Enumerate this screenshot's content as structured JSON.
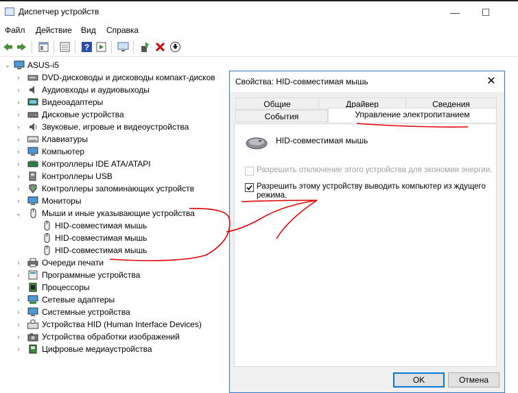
{
  "window": {
    "title": "Диспетчер устройств",
    "controls": {
      "minimize": "—",
      "maximize": "☐"
    }
  },
  "menu": [
    "Файл",
    "Действие",
    "Вид",
    "Справка"
  ],
  "toolbar": {
    "icons": [
      "back-arrow-icon",
      "forward-arrow-icon",
      "properties-icon",
      "update-list-icon",
      "help-icon",
      "action-icon",
      "scan-monitor-icon",
      "enable-device-icon",
      "remove-device-icon",
      "download-driver-icon"
    ]
  },
  "tree": {
    "root": "ASUS-i5",
    "items": [
      {
        "label": "DVD-дисководы и дисководы компакт-дисков",
        "icon": "dvd-icon"
      },
      {
        "label": "Аудиовходы и аудиовыходы",
        "icon": "speaker-icon"
      },
      {
        "label": "Видеоадаптеры",
        "icon": "display-adapter-icon"
      },
      {
        "label": "Дисковые устройства",
        "icon": "disk-drive-icon"
      },
      {
        "label": "Звуковые, игровые и видеоустройства",
        "icon": "sound-icon"
      },
      {
        "label": "Клавиатуры",
        "icon": "keyboard-icon"
      },
      {
        "label": "Компьютер",
        "icon": "computer-icon"
      },
      {
        "label": "Контроллеры IDE ATA/ATAPI",
        "icon": "ide-controller-icon"
      },
      {
        "label": "Контроллеры USB",
        "icon": "usb-icon"
      },
      {
        "label": "Контроллеры запоминающих устройств",
        "icon": "storage-controller-icon"
      },
      {
        "label": "Мониторы",
        "icon": "monitor-icon"
      },
      {
        "label": "Мыши и иные указывающие устройства",
        "icon": "mouse-icon",
        "expanded": true,
        "children": [
          "HID-совместимая мышь",
          "HID-совместимая мышь",
          "HID-совместимая мышь"
        ]
      },
      {
        "label": "Очереди печати",
        "icon": "printer-icon"
      },
      {
        "label": "Программные устройства",
        "icon": "software-device-icon"
      },
      {
        "label": "Процессоры",
        "icon": "processor-icon"
      },
      {
        "label": "Сетевые адаптеры",
        "icon": "network-adapter-icon"
      },
      {
        "label": "Системные устройства",
        "icon": "system-device-icon"
      },
      {
        "label": "Устройства HID (Human Interface Devices)",
        "icon": "hid-icon"
      },
      {
        "label": "Устройства обработки изображений",
        "icon": "camera-icon"
      },
      {
        "label": "Цифровые медиаустройства",
        "icon": "media-device-icon"
      }
    ]
  },
  "dialog": {
    "title": "Свойства: HID-совместимая мышь",
    "close": "✕",
    "tabs_top": [
      "Общие",
      "Драйвер",
      "Сведения"
    ],
    "tabs_bottom": [
      "События",
      "Управление электропитанием"
    ],
    "active_tab": "Управление электропитанием",
    "device_name": "HID-совместимая мышь",
    "option_allow_off": {
      "label": "Разрешить отключение этого устройства для экономии энергии.",
      "checked": false,
      "disabled": true
    },
    "option_wake": {
      "label": "Разрешить этому устройству выводить компьютер из ждущего режима.",
      "checked": true,
      "disabled": false
    },
    "ok": "OK",
    "cancel": "Отмена"
  },
  "colors": {
    "accent": "#0078d7",
    "annotation": "#e00000"
  }
}
